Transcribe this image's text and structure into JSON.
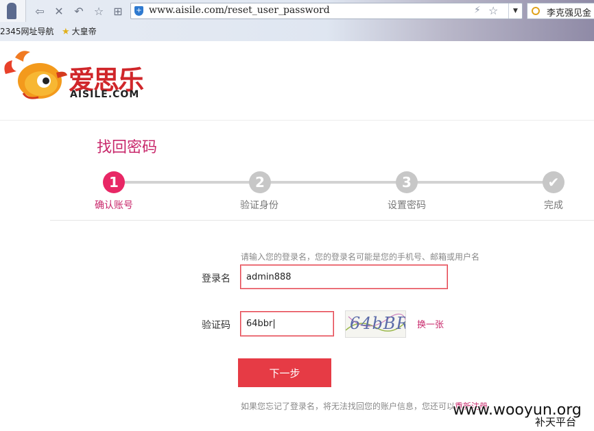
{
  "browser": {
    "url": "www.aisile.com/reset_user_password",
    "search_text": "李克强见金",
    "bookmarks": [
      {
        "label": "2345网址导航"
      },
      {
        "label": "大皇帝"
      }
    ]
  },
  "logo": {
    "title": "爱思乐",
    "subtitle": "AISILE.COM"
  },
  "page": {
    "title": "找回密码",
    "steps": [
      {
        "number": "1",
        "label": "确认账号",
        "status": "active"
      },
      {
        "number": "2",
        "label": "验证身份",
        "status": "pending"
      },
      {
        "number": "3",
        "label": "设置密码",
        "status": "pending"
      },
      {
        "number": "✔",
        "label": "完成",
        "status": "pending"
      }
    ],
    "form": {
      "hint": "请输入您的登录名，您的登录名可能是您的手机号、邮箱或用户名",
      "username_label": "登录名",
      "username_value": "admin888",
      "captcha_label": "验证码",
      "captcha_value": "64bbr",
      "captcha_image_text": "64bBR",
      "refresh_label": "换一张",
      "next_label": "下一步"
    },
    "footer": {
      "text": "如果您忘记了登录名，将无法找回您的账户信息，您还可以",
      "link": "重新注册"
    }
  },
  "watermark": {
    "site": "www.wooyun.org",
    "label": "补天平台"
  },
  "colors": {
    "accent": "#c8286b",
    "active_step": "#e82765",
    "button": "#e63b45",
    "input_border": "#e4434e"
  }
}
